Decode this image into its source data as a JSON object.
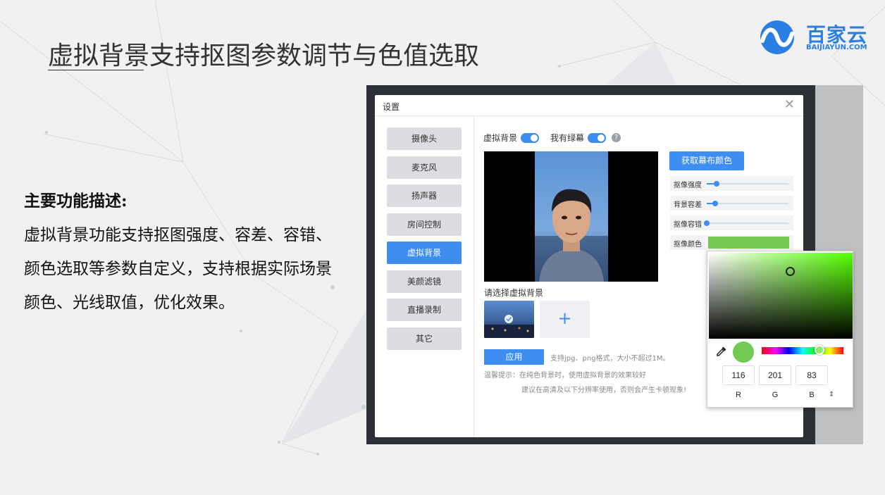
{
  "slide": {
    "title": "虚拟背景支持抠图参数调节与色值选取",
    "logo_text": "百家云",
    "logo_domain": "BAIJIAYUN.COM"
  },
  "description": {
    "heading": "主要功能描述:",
    "body": "虚拟背景功能支持抠图强度、容差、容错、颜色选取等参数自定义，支持根据实际场景颜色、光线取值，优化效果。"
  },
  "dialog": {
    "title": "设置",
    "close_icon": "close-icon",
    "sidebar": {
      "items": [
        {
          "label": "摄像头",
          "active": false
        },
        {
          "label": "麦克风",
          "active": false
        },
        {
          "label": "扬声器",
          "active": false
        },
        {
          "label": "房间控制",
          "active": false
        },
        {
          "label": "虚拟背景",
          "active": true
        },
        {
          "label": "美颜滤镜",
          "active": false
        },
        {
          "label": "直播录制",
          "active": false
        },
        {
          "label": "其它",
          "active": false
        }
      ]
    },
    "toggles": {
      "virtual_bg_label": "虚拟背景",
      "virtual_bg_on": true,
      "green_screen_label": "我有绿幕",
      "green_screen_on": true,
      "help_icon": "?"
    },
    "choose_label": "请选择虚拟背景",
    "add_icon": "+",
    "apply_label": "应用",
    "apply_note": "支持jpg、png格式，大小不超过1M。",
    "tip_line1": "温馨提示：在纯色背景时，使用虚拟背景的效果较好",
    "tip_line2": "建议在高清及以下分辨率使用，否则会产生卡顿现象!",
    "get_color_label": "获取幕布颜色",
    "sliders": [
      {
        "label": "抠像强度",
        "value": 0.12
      },
      {
        "label": "背景容差",
        "value": 0.1
      },
      {
        "label": "抠像容错",
        "value": 0.0
      }
    ],
    "color_row_label": "抠像颜色",
    "key_color": "#74c953"
  },
  "color_picker": {
    "r": "116",
    "g": "201",
    "b": "83",
    "r_label": "R",
    "g_label": "G",
    "b_label": "B",
    "mode_toggle": "⌃⌄",
    "hue_color": "#55ff00"
  }
}
